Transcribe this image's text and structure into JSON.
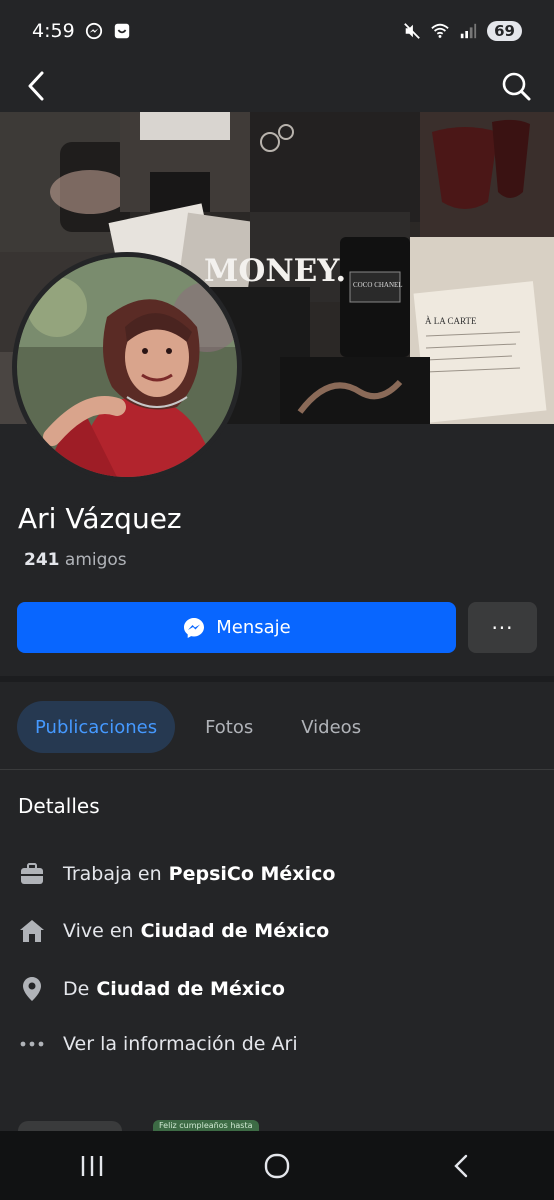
{
  "status_bar": {
    "time": "4:59",
    "battery": "69",
    "icons": [
      "messenger-icon",
      "app-icon",
      "mute-icon",
      "wifi-icon",
      "signal-icon"
    ]
  },
  "topnav": {
    "back_icon": "chevron-left-icon",
    "search_icon": "search-icon"
  },
  "cover": {
    "text": "MONEY.",
    "chanel_label": "COCO CHANEL",
    "menu_title": "À LA CARTE"
  },
  "profile": {
    "name": "Ari Vázquez",
    "friends_count": "241",
    "friends_label": "amigos"
  },
  "actions": {
    "message_label": "Mensaje",
    "more_label": "···"
  },
  "tabs": [
    {
      "label": "Publicaciones",
      "active": true
    },
    {
      "label": "Fotos",
      "active": false
    },
    {
      "label": "Videos",
      "active": false
    }
  ],
  "details": {
    "title": "Detalles",
    "items": [
      {
        "icon": "briefcase-icon",
        "prefix": "Trabaja en",
        "value": "PepsiCo México"
      },
      {
        "icon": "home-icon",
        "prefix": "Vive en",
        "value": "Ciudad de México"
      },
      {
        "icon": "location-pin-icon",
        "prefix": "De",
        "value": "Ciudad de México"
      },
      {
        "icon": "more-dots-icon",
        "prefix": "Ver la información de Ari",
        "value": ""
      }
    ]
  },
  "peek_text": "Feliz cumpleaños hasta",
  "colors": {
    "background": "#242527",
    "primary_button": "#0866ff",
    "active_tab_bg": "#263951",
    "active_tab_text": "#4599ff"
  }
}
